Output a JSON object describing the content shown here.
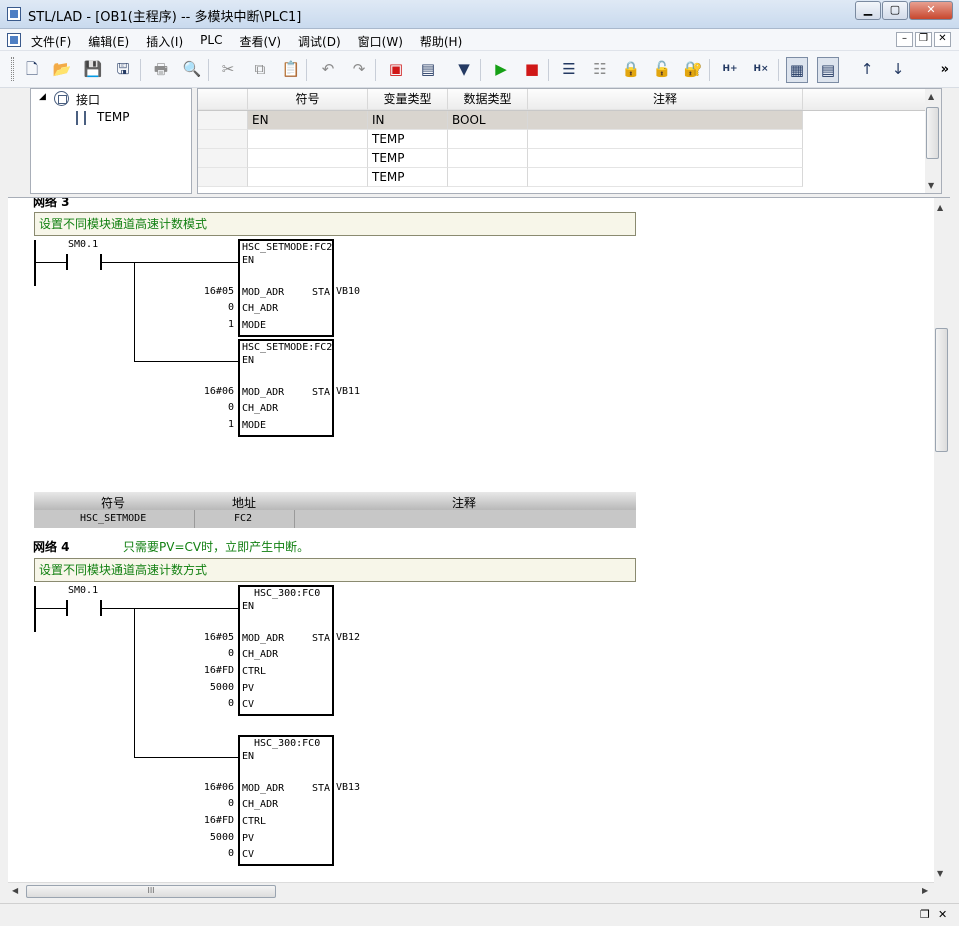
{
  "window": {
    "title": "STL/LAD - [OB1(主程序) -- 多模块中断\\PLC1]"
  },
  "menu": [
    "文件(F)",
    "编辑(E)",
    "插入(I)",
    "PLC",
    "查看(V)",
    "调试(D)",
    "窗口(W)",
    "帮助(H)"
  ],
  "interface_tree": {
    "root": "接口",
    "child": "TEMP"
  },
  "var_table": {
    "headers": [
      "符号",
      "变量类型",
      "数据类型",
      "注释"
    ],
    "rows": [
      {
        "symbol": "EN",
        "var_type": "IN",
        "data_type": "BOOL",
        "comment": ""
      },
      {
        "symbol": "",
        "var_type": "TEMP",
        "data_type": "",
        "comment": ""
      },
      {
        "symbol": "",
        "var_type": "TEMP",
        "data_type": "",
        "comment": ""
      },
      {
        "symbol": "",
        "var_type": "TEMP",
        "data_type": "",
        "comment": ""
      }
    ]
  },
  "network3": {
    "title_fragment": "网络 3",
    "comment": "设置不同模块通道高速计数模式",
    "contact": "SM0.1",
    "blocks": [
      {
        "name": "HSC_SETMODE:FC2",
        "en": "EN",
        "inputs": [
          {
            "pin": "MOD_ADR",
            "value": "16#05"
          },
          {
            "pin": "CH_ADR",
            "value": "0"
          },
          {
            "pin": "MODE",
            "value": "1"
          }
        ],
        "out_pin": "STA",
        "out_value": "VB10"
      },
      {
        "name": "HSC_SETMODE:FC2",
        "en": "EN",
        "inputs": [
          {
            "pin": "MOD_ADR",
            "value": "16#06"
          },
          {
            "pin": "CH_ADR",
            "value": "0"
          },
          {
            "pin": "MODE",
            "value": "1"
          }
        ],
        "out_pin": "STA",
        "out_value": "VB11"
      }
    ]
  },
  "symbol_table": {
    "headers": [
      "符号",
      "地址",
      "注释"
    ],
    "row": {
      "symbol": "HSC_SETMODE",
      "address": "FC2",
      "comment": ""
    }
  },
  "network4": {
    "title": "网络 4",
    "title_comment": "只需要PV=CV时，立即产生中断。",
    "comment": "设置不同模块通道高速计数方式",
    "contact": "SM0.1",
    "blocks": [
      {
        "name": "HSC_300:FC0",
        "en": "EN",
        "inputs": [
          {
            "pin": "MOD_ADR",
            "value": "16#05"
          },
          {
            "pin": "CH_ADR",
            "value": "0"
          },
          {
            "pin": "CTRL",
            "value": "16#FD"
          },
          {
            "pin": "PV",
            "value": "5000"
          },
          {
            "pin": "CV",
            "value": "0"
          }
        ],
        "out_pin": "STA",
        "out_value": "VB12"
      },
      {
        "name": "HSC_300:FC0",
        "en": "EN",
        "inputs": [
          {
            "pin": "MOD_ADR",
            "value": "16#06"
          },
          {
            "pin": "CH_ADR",
            "value": "0"
          },
          {
            "pin": "CTRL",
            "value": "16#FD"
          },
          {
            "pin": "PV",
            "value": "5000"
          },
          {
            "pin": "CV",
            "value": "0"
          }
        ],
        "out_pin": "STA",
        "out_value": "VB13"
      }
    ]
  },
  "scroll": {
    "h_thumb_grip": "III"
  },
  "icons": {
    "toolbar": [
      "new-icon",
      "open-icon",
      "save-icon",
      "save-all-icon",
      "print-icon",
      "print-preview-icon",
      "cut-icon",
      "copy-icon",
      "paste-icon",
      "undo-icon",
      "redo-icon",
      "compile-icon",
      "compile-all-icon",
      "download-icon",
      "run-icon",
      "stop-icon",
      "upload-icon",
      "compare-icon",
      "lock-icon",
      "unlock-icon",
      "protect-icon",
      "insert-network-icon",
      "delete-network-icon",
      "lad-view-icon",
      "stl-view-icon",
      "move-up-icon",
      "move-down-icon"
    ]
  }
}
